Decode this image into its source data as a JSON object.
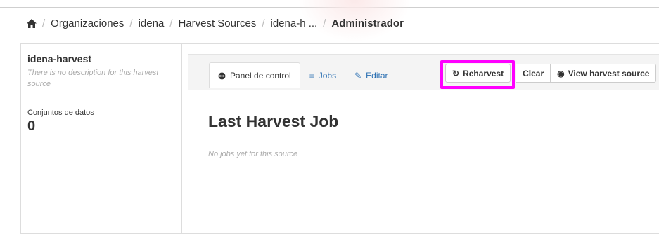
{
  "breadcrumb": {
    "items": [
      "Organizaciones",
      "idena",
      "Harvest Sources",
      "idena-h ..."
    ],
    "active": "Administrador"
  },
  "sidebar": {
    "title": "idena-harvest",
    "description": "There is no description for this harvest source",
    "stat_label": "Conjuntos de datos",
    "stat_value": "0"
  },
  "tabs": [
    {
      "label": "Panel de control",
      "icon": "dashboard-icon",
      "active": true
    },
    {
      "label": "Jobs",
      "icon": "list-icon",
      "active": false
    },
    {
      "label": "Editar",
      "icon": "edit-icon",
      "active": false
    }
  ],
  "actions": {
    "reharvest_label": "Reharvest",
    "clear_label": "Clear",
    "view_label": "View harvest source"
  },
  "main": {
    "title": "Last Harvest Job",
    "empty_message": "No jobs yet for this source"
  },
  "colors": {
    "link": "#2a6fb2",
    "highlight": "#ff00ff"
  }
}
